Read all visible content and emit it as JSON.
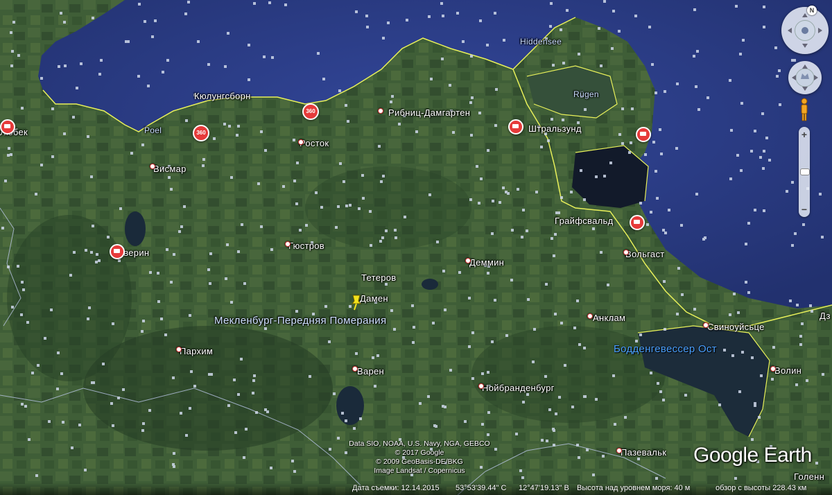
{
  "map": {
    "colors": {
      "sea": "#2d3e86",
      "land": "#3c5a36",
      "coast": "#e8f05a"
    },
    "cities": [
      {
        "name": "Кюлунгсборн"
      },
      {
        "name": "Любек"
      },
      {
        "name": "Poel"
      },
      {
        "name": "Висмар"
      },
      {
        "name": "Росток"
      },
      {
        "name": "Рибниц-Дамгартен"
      },
      {
        "name": "Hiddensee"
      },
      {
        "name": "Rügen"
      },
      {
        "name": "Штральзунд"
      },
      {
        "name": "Грайфсвальд"
      },
      {
        "name": "Вольгаст"
      },
      {
        "name": "Гюстров"
      },
      {
        "name": "Шверин"
      },
      {
        "name": "Тетеров"
      },
      {
        "name": "Деммин"
      },
      {
        "name": "Дамен"
      },
      {
        "name": "Мекленбург-Передняя Померания"
      },
      {
        "name": "Анклам"
      },
      {
        "name": "Свиноуйсьце"
      },
      {
        "name": "Бодденгевессер Ост"
      },
      {
        "name": "Пархим"
      },
      {
        "name": "Варен"
      },
      {
        "name": "Нойбранденбург"
      },
      {
        "name": "Волин"
      },
      {
        "name": "Пазевальк"
      },
      {
        "name": "Голенн"
      },
      {
        "name": "Дз"
      }
    ],
    "badges": {
      "label_360": "360"
    }
  },
  "credits": {
    "line1": "Data SIO, NOAA, U.S. Navy, NGA, GEBCO",
    "line2": "© 2017 Google",
    "line3": "© 2009 GeoBasis-DE/BKG",
    "line4": "Image Landsat / Copernicus"
  },
  "logo": "Google Earth",
  "status": {
    "date": "Дата съемки: 12.14.2015",
    "lat": "53°53'39.44\" С",
    "lon": "12°47'19.13\" В",
    "elevation": "Высота над уровнем моря:   40 м",
    "eye": "обзор с высоты 228.43 км"
  },
  "controls": {
    "north": "N",
    "zoom_in": "+",
    "zoom_out": "−"
  },
  "icons": [
    "compass-icon",
    "look-joystick-icon",
    "pegman-icon",
    "zoom-slider-icon",
    "placemark-pin-icon",
    "photo-360-icon",
    "camera-icon"
  ]
}
